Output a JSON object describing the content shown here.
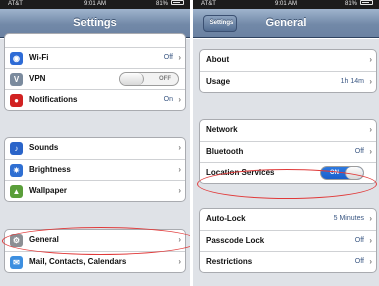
{
  "left": {
    "status": {
      "carrier": "AT&T",
      "time": "9:01 AM",
      "battery": "81%"
    },
    "title": "Settings",
    "groups": [
      [
        {
          "icon": "wifi-icon",
          "color": "#2d6bd6",
          "glyph": "◉",
          "label": "Wi-Fi",
          "value": "Off"
        },
        {
          "icon": "vpn-icon",
          "color": "#7b8b9e",
          "glyph": "V",
          "label": "VPN",
          "toggle": "OFF"
        },
        {
          "icon": "notifications-icon",
          "color": "#d12222",
          "glyph": "●",
          "label": "Notifications",
          "value": "On"
        }
      ],
      [
        {
          "icon": "sounds-icon",
          "color": "#2a64c9",
          "glyph": "♪",
          "label": "Sounds"
        },
        {
          "icon": "brightness-icon",
          "color": "#2f6fd2",
          "glyph": "✷",
          "label": "Brightness"
        },
        {
          "icon": "wallpaper-icon",
          "color": "#5a9e3a",
          "glyph": "▲",
          "label": "Wallpaper"
        }
      ],
      [
        {
          "icon": "gear-icon",
          "color": "#8c8f94",
          "glyph": "⚙",
          "label": "General"
        },
        {
          "icon": "mail-icon",
          "color": "#3d8fe0",
          "glyph": "✉",
          "label": "Mail, Contacts, Calendars"
        }
      ]
    ]
  },
  "right": {
    "status": {
      "carrier": "AT&T",
      "time": "9:01 AM",
      "battery": "81%"
    },
    "back_label": "Settings",
    "title": "General",
    "groups": [
      [
        {
          "label": "About"
        },
        {
          "label": "Usage",
          "value": "1h 14m"
        }
      ],
      [
        {
          "label": "Network"
        },
        {
          "label": "Bluetooth",
          "value": "Off"
        },
        {
          "label": "Location Services",
          "toggle": "ON"
        }
      ],
      [
        {
          "label": "Auto-Lock",
          "value": "5 Minutes"
        },
        {
          "label": "Passcode Lock",
          "value": "Off"
        },
        {
          "label": "Restrictions",
          "value": "Off"
        }
      ]
    ]
  },
  "chevron": "›",
  "accent_red": "#e03a3a"
}
